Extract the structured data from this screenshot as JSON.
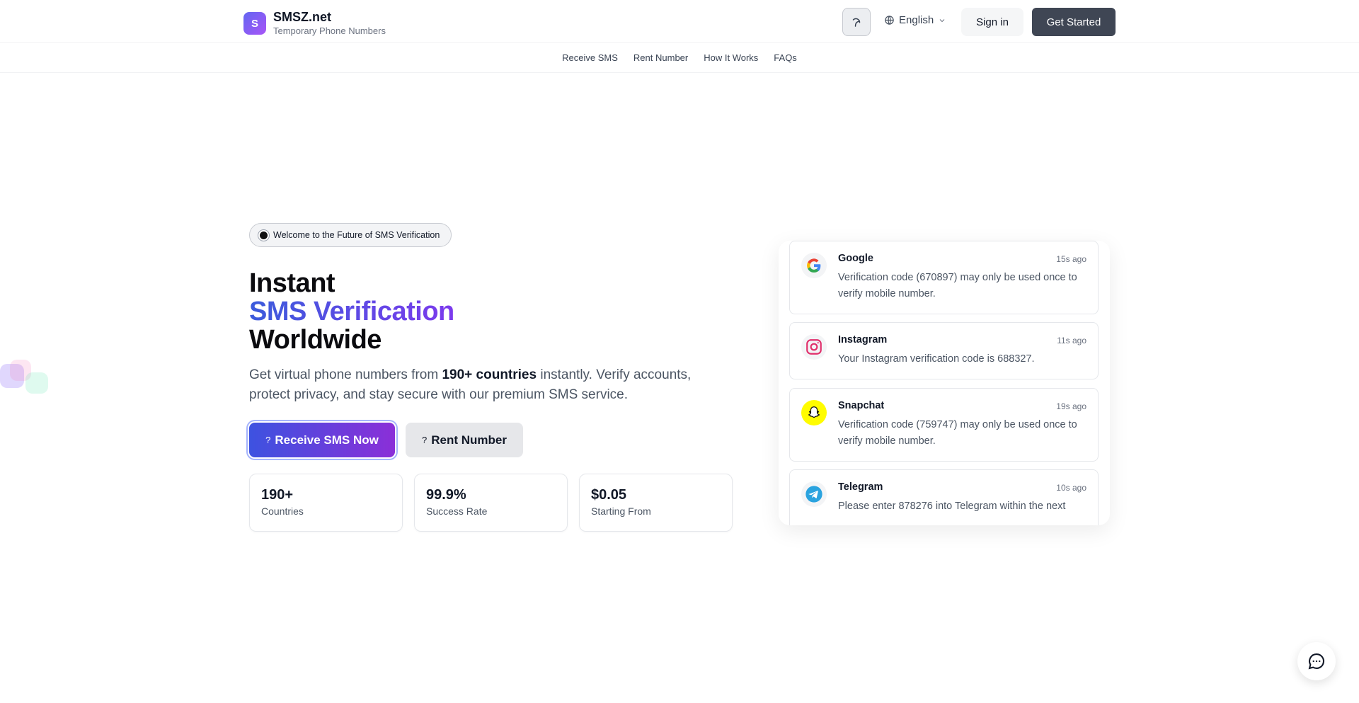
{
  "brand": {
    "logo_letter": "S",
    "name": "SMSZ.net",
    "tagline": "Temporary Phone Numbers"
  },
  "header": {
    "language": "English",
    "signin_label": "Sign in",
    "get_started_label": "Get Started"
  },
  "nav": {
    "items": [
      "Receive SMS",
      "Rent Number",
      "How It Works",
      "FAQs"
    ]
  },
  "hero": {
    "badge": "Welcome to the Future of SMS Verification",
    "headline_line1": "Instant",
    "headline_line2": "SMS Verification",
    "headline_line3": "Worldwide",
    "subtitle_pre": "Get virtual phone numbers from ",
    "subtitle_bold": "190+ countries",
    "subtitle_post": " instantly. Verify accounts, protect privacy, and stay secure with our premium SMS service.",
    "primary_cta": "Receive SMS Now",
    "secondary_cta": "Rent Number",
    "cta_glyph": "?"
  },
  "stats": [
    {
      "value": "190+",
      "label": "Countries"
    },
    {
      "value": "99.9%",
      "label": "Success Rate"
    },
    {
      "value": "$0.05",
      "label": "Starting From"
    }
  ],
  "messages": [
    {
      "service": "Google",
      "time": "15s ago",
      "text": "Verification code (670897) may only be used once to verify mobile number.",
      "icon": "google-icon"
    },
    {
      "service": "Instagram",
      "time": "11s ago",
      "text": "Your Instagram verification code is 688327.",
      "icon": "instagram-icon"
    },
    {
      "service": "Snapchat",
      "time": "19s ago",
      "text": "Verification code (759747) may only be used once to verify mobile number.",
      "icon": "snapchat-icon"
    },
    {
      "service": "Telegram",
      "time": "10s ago",
      "text": "Please enter 878276 into Telegram within the next",
      "icon": "telegram-icon"
    }
  ],
  "colors": {
    "accent_start": "#3d52e0",
    "accent_end": "#8b2fd8",
    "dark_button": "#3f4654"
  }
}
